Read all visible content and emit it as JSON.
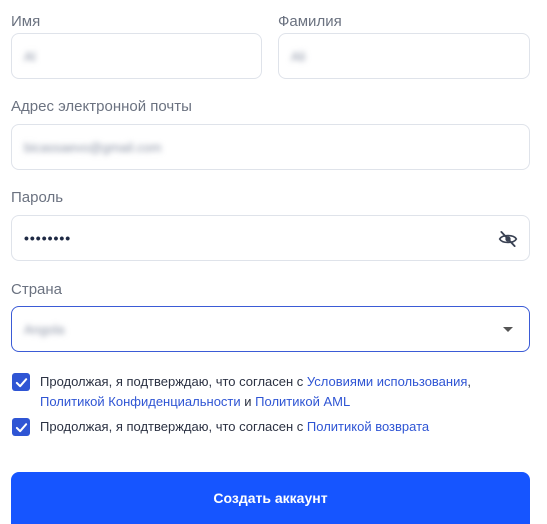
{
  "form": {
    "first_name": {
      "label": "Имя",
      "value": "Al"
    },
    "last_name": {
      "label": "Фамилия",
      "value": "Ali"
    },
    "email": {
      "label": "Адрес электронной почты",
      "value": "bicassaevo@gmail.com"
    },
    "password": {
      "label": "Пароль",
      "value": "••••••••"
    },
    "country": {
      "label": "Страна",
      "value": "Angola"
    }
  },
  "consent1": {
    "prefix": "Продолжая, я подтверждаю, что согласен с ",
    "terms_link": "Условиями использования",
    "comma": ",",
    "privacy_link": "Политикой Конфиденциальности",
    "and": " и ",
    "aml_link": "Политикой AML"
  },
  "consent2": {
    "prefix": "Продолжая, я подтверждаю, что согласен с ",
    "refund_link": "Политикой возврата"
  },
  "submit_label": "Создать аккаунт",
  "colors": {
    "accent": "#2f55d4",
    "button": "#1655ff",
    "border": "#dfe3ea"
  }
}
